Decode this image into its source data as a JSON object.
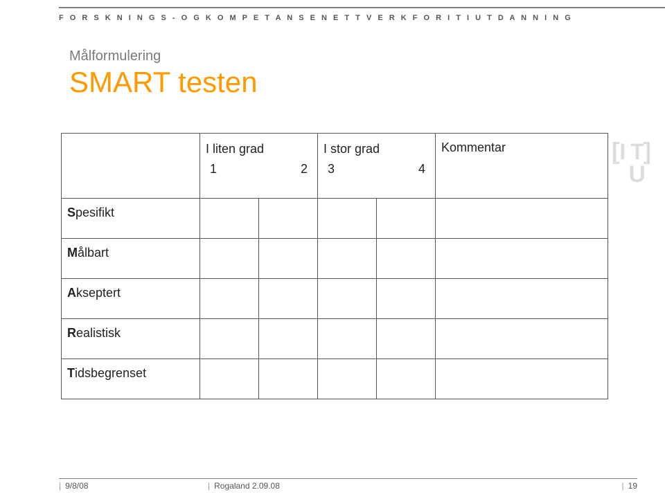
{
  "header": {
    "org_label": "F O R S K N I N G S -  O G  K O M P E T A N S E N E T T V E R K  F O R  I T  I  U T D A N N I N G"
  },
  "title_block": {
    "subtitle": "Målformulering",
    "title": "SMART testen"
  },
  "table": {
    "col1_top": "I liten grad",
    "col1_n1": "1",
    "col1_n2": "2",
    "col3_top": "I stor grad",
    "col3_n1": "3",
    "col3_n2": "4",
    "comment_header": "Kommentar",
    "rows": [
      {
        "first": "S",
        "rest": "pesifikt"
      },
      {
        "first": "M",
        "rest": "ålbart"
      },
      {
        "first": "A",
        "rest": "kseptert"
      },
      {
        "first": "R",
        "rest": "ealistisk"
      },
      {
        "first": "T",
        "rest": "idsbegrenset"
      }
    ]
  },
  "logo": {
    "it": "I T",
    "u": "U",
    "lb": "[",
    "rb": "]"
  },
  "footer": {
    "date": "9/8/08",
    "location": "Rogaland 2.09.08",
    "page": "19"
  }
}
